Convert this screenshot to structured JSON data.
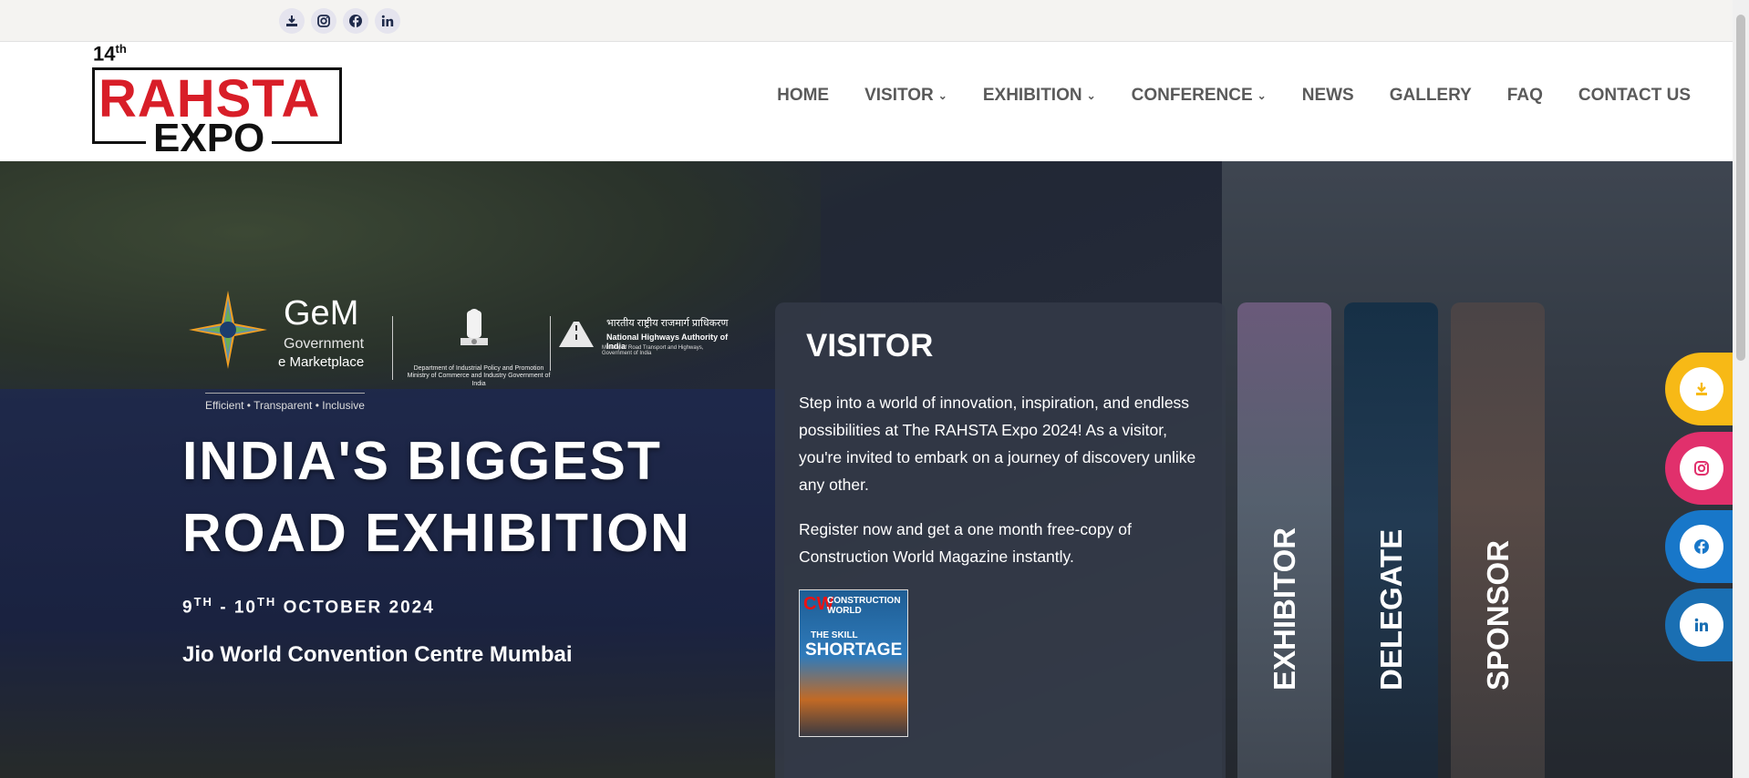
{
  "topbar": {
    "icons": [
      "download-icon",
      "instagram-icon",
      "facebook-icon",
      "linkedin-icon"
    ]
  },
  "logo": {
    "edition": "14",
    "edition_suffix": "th",
    "word1": "RAHSTA",
    "word2": "EXPO"
  },
  "nav": {
    "items": [
      {
        "label": "HOME",
        "dropdown": false
      },
      {
        "label": "VISITOR",
        "dropdown": true
      },
      {
        "label": "EXHIBITION",
        "dropdown": true
      },
      {
        "label": "CONFERENCE",
        "dropdown": true
      },
      {
        "label": "NEWS",
        "dropdown": false
      },
      {
        "label": "GALLERY",
        "dropdown": false
      },
      {
        "label": "FAQ",
        "dropdown": false
      },
      {
        "label": "CONTACT US",
        "dropdown": false
      }
    ]
  },
  "partners": {
    "gem_title": "GeM",
    "gem_sub1": "Government",
    "gem_sub2": "e Marketplace",
    "gem_tagline": "Efficient • Transparent • Inclusive",
    "dipp": "Department of Industrial Policy and Promotion Ministry of Commerce and Industry Government of India",
    "nhai_hindi": "भारतीय राष्ट्रीय राजमार्ग प्राधिकरण",
    "nhai_english": "National Highways Authority of India",
    "nhai_sub": "Ministry of Road Transport and Highways, Government of India"
  },
  "hero": {
    "headline_line1": "INDIA'S BIGGEST",
    "headline_line2": "ROAD EXHIBITION",
    "date_day1": "9",
    "date_sup1": "TH",
    "date_sep": " - ",
    "date_day2": "10",
    "date_sup2": "TH",
    "date_rest": " OCTOBER 2024",
    "venue": "Jio World Convention Centre Mumbai"
  },
  "visitor_card": {
    "title": "VISITOR",
    "paragraph1": "Step into a world of innovation, inspiration, and endless possibilities at The RAHSTA Expo 2024! As a visitor, you're invited to embark on a journey of discovery unlike any other.",
    "paragraph2": "Register now and get a one month free-copy of Construction World Magazine instantly.",
    "magazine": {
      "brand": "CW",
      "name": "CONSTRUCTION WORLD",
      "kicker": "THE SKILL",
      "headline": "SHORTAGE"
    }
  },
  "vertical_cards": [
    {
      "label": "EXHIBITOR"
    },
    {
      "label": "DELEGATE"
    },
    {
      "label": "SPONSOR"
    }
  ],
  "floating_social": [
    {
      "icon": "download-icon",
      "color": "#f7b916"
    },
    {
      "icon": "instagram-icon",
      "color": "#e1306c"
    },
    {
      "icon": "facebook-icon",
      "color": "#1877c9"
    },
    {
      "icon": "linkedin-icon",
      "color": "#1a6fb3"
    }
  ]
}
